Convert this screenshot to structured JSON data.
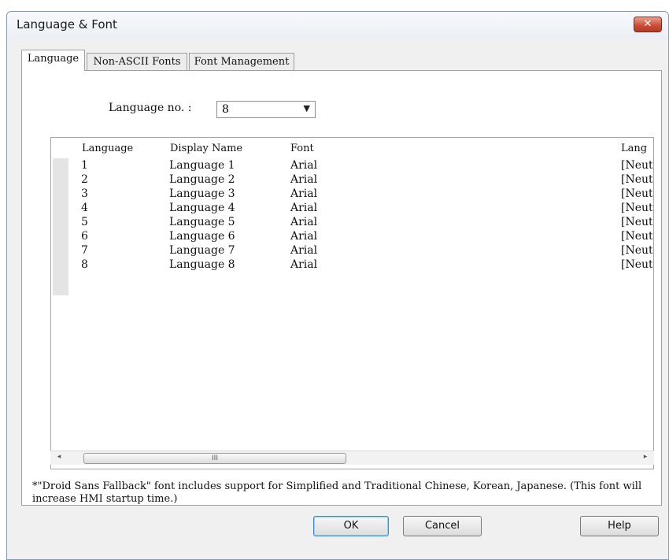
{
  "window": {
    "title": "Language & Font",
    "close_label": "✕"
  },
  "tabs": [
    {
      "label": "Language",
      "active": true
    },
    {
      "label": "Non-ASCII Fonts",
      "active": false
    },
    {
      "label": "Font Management",
      "active": false
    }
  ],
  "language_no": {
    "label": "Language no. :",
    "value": "8"
  },
  "table": {
    "columns": [
      "Language",
      "Display Name",
      "Font",
      "Lang"
    ],
    "rows": [
      [
        "1",
        "Language 1",
        "Arial",
        "[Neut"
      ],
      [
        "2",
        "Language 2",
        "Arial",
        "[Neut"
      ],
      [
        "3",
        "Language 3",
        "Arial",
        "[Neut"
      ],
      [
        "4",
        "Language 4",
        "Arial",
        "[Neut"
      ],
      [
        "5",
        "Language 5",
        "Arial",
        "[Neut"
      ],
      [
        "6",
        "Language 6",
        "Arial",
        "[Neut"
      ],
      [
        "7",
        "Language 7",
        "Arial",
        "[Neut"
      ],
      [
        "8",
        "Language 8",
        "Arial",
        "[Neut"
      ]
    ]
  },
  "scrollbar": {
    "left_arrow": "◂",
    "right_arrow": "▸",
    "grip": "III"
  },
  "note": "*\"Droid Sans Fallback\" font includes support for Simplified and Traditional Chinese, Korean, Japanese. (This font will increase HMI startup time.)",
  "buttons": {
    "ok": "OK",
    "cancel": "Cancel",
    "help": "Help"
  }
}
